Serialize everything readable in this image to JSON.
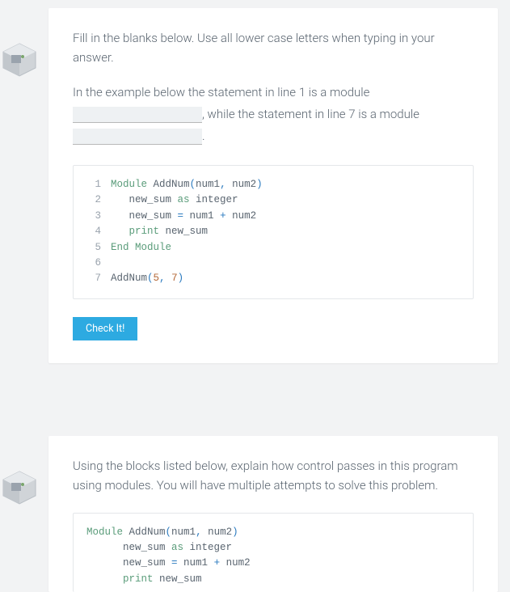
{
  "q1": {
    "intro": "Fill in the blanks below. Use all lower case letters when typing in your answer.",
    "stem_part1": "In the example below the statement in line 1 is a module ",
    "stem_mid": ", while the statement in line 7 is a module ",
    "stem_end": ".",
    "blank1_value": "",
    "blank2_value": "",
    "code": {
      "lines": [
        {
          "n": "1",
          "pre": "",
          "tokens": [
            [
              "kw",
              "Module "
            ],
            [
              "fn",
              "AddNum"
            ],
            [
              "paren",
              "("
            ],
            [
              "arg",
              "num1"
            ],
            [
              "paren",
              ","
            ],
            [
              "arg",
              " num2"
            ],
            [
              "paren",
              ")"
            ]
          ]
        },
        {
          "n": "2",
          "pre": "   ",
          "tokens": [
            [
              "arg",
              "new_sum "
            ],
            [
              "kw",
              "as"
            ],
            [
              "arg",
              " integer"
            ]
          ]
        },
        {
          "n": "3",
          "pre": "   ",
          "tokens": [
            [
              "arg",
              "new_sum "
            ],
            [
              "paren",
              "="
            ],
            [
              "arg",
              " num1 "
            ],
            [
              "paren",
              "+"
            ],
            [
              "arg",
              " num2"
            ]
          ]
        },
        {
          "n": "4",
          "pre": "   ",
          "tokens": [
            [
              "kw",
              "print"
            ],
            [
              "arg",
              " new_sum"
            ]
          ]
        },
        {
          "n": "5",
          "pre": "",
          "tokens": [
            [
              "kw",
              "End Module"
            ]
          ]
        },
        {
          "n": "6",
          "pre": "",
          "tokens": []
        },
        {
          "n": "7",
          "pre": "",
          "tokens": [
            [
              "fn",
              "AddNum"
            ],
            [
              "paren",
              "("
            ],
            [
              "num",
              "5"
            ],
            [
              "paren",
              ","
            ],
            [
              "arg",
              " "
            ],
            [
              "num",
              "7"
            ],
            [
              "paren",
              ")"
            ]
          ]
        }
      ]
    },
    "check_label": "Check It!"
  },
  "q2": {
    "intro": "Using the blocks listed below, explain how control passes in this program using modules. You will have multiple attempts to solve this problem.",
    "code": {
      "lines": [
        {
          "pre": "",
          "tokens": [
            [
              "kw",
              "Module "
            ],
            [
              "fn",
              "AddNum"
            ],
            [
              "paren",
              "("
            ],
            [
              "arg",
              "num1"
            ],
            [
              "paren",
              ","
            ],
            [
              "arg",
              " num2"
            ],
            [
              "paren",
              ")"
            ]
          ]
        },
        {
          "pre": "      ",
          "tokens": [
            [
              "arg",
              "new_sum "
            ],
            [
              "kw",
              "as"
            ],
            [
              "arg",
              " integer"
            ]
          ]
        },
        {
          "pre": "      ",
          "tokens": [
            [
              "arg",
              "new_sum "
            ],
            [
              "paren",
              "="
            ],
            [
              "arg",
              " num1 "
            ],
            [
              "paren",
              "+"
            ],
            [
              "arg",
              " num2"
            ]
          ]
        },
        {
          "pre": "      ",
          "tokens": [
            [
              "kw",
              "print"
            ],
            [
              "arg",
              " new_sum"
            ]
          ]
        }
      ]
    }
  }
}
